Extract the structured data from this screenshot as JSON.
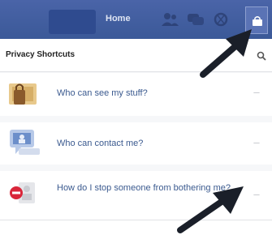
{
  "topbar": {
    "home_label": "Home",
    "color": "#3b5998",
    "icons": [
      "friends-icon",
      "messages-icon",
      "globe-icon",
      "settings-lock-icon"
    ]
  },
  "shortcuts": {
    "title": "Privacy Shortcuts",
    "search_icon": "search-icon",
    "items": [
      {
        "label": "Who can see my stuff?",
        "icon": "lock-padlock-icon"
      },
      {
        "label": "Who can contact me?",
        "icon": "contact-chat-icon"
      },
      {
        "label": "How do I stop someone from bothering me?",
        "icon": "block-person-icon"
      }
    ]
  },
  "annotations": {
    "arrow_color": "#1a1f29",
    "arrows": [
      "arrow-to-settings",
      "arrow-to-bothering-item"
    ]
  }
}
